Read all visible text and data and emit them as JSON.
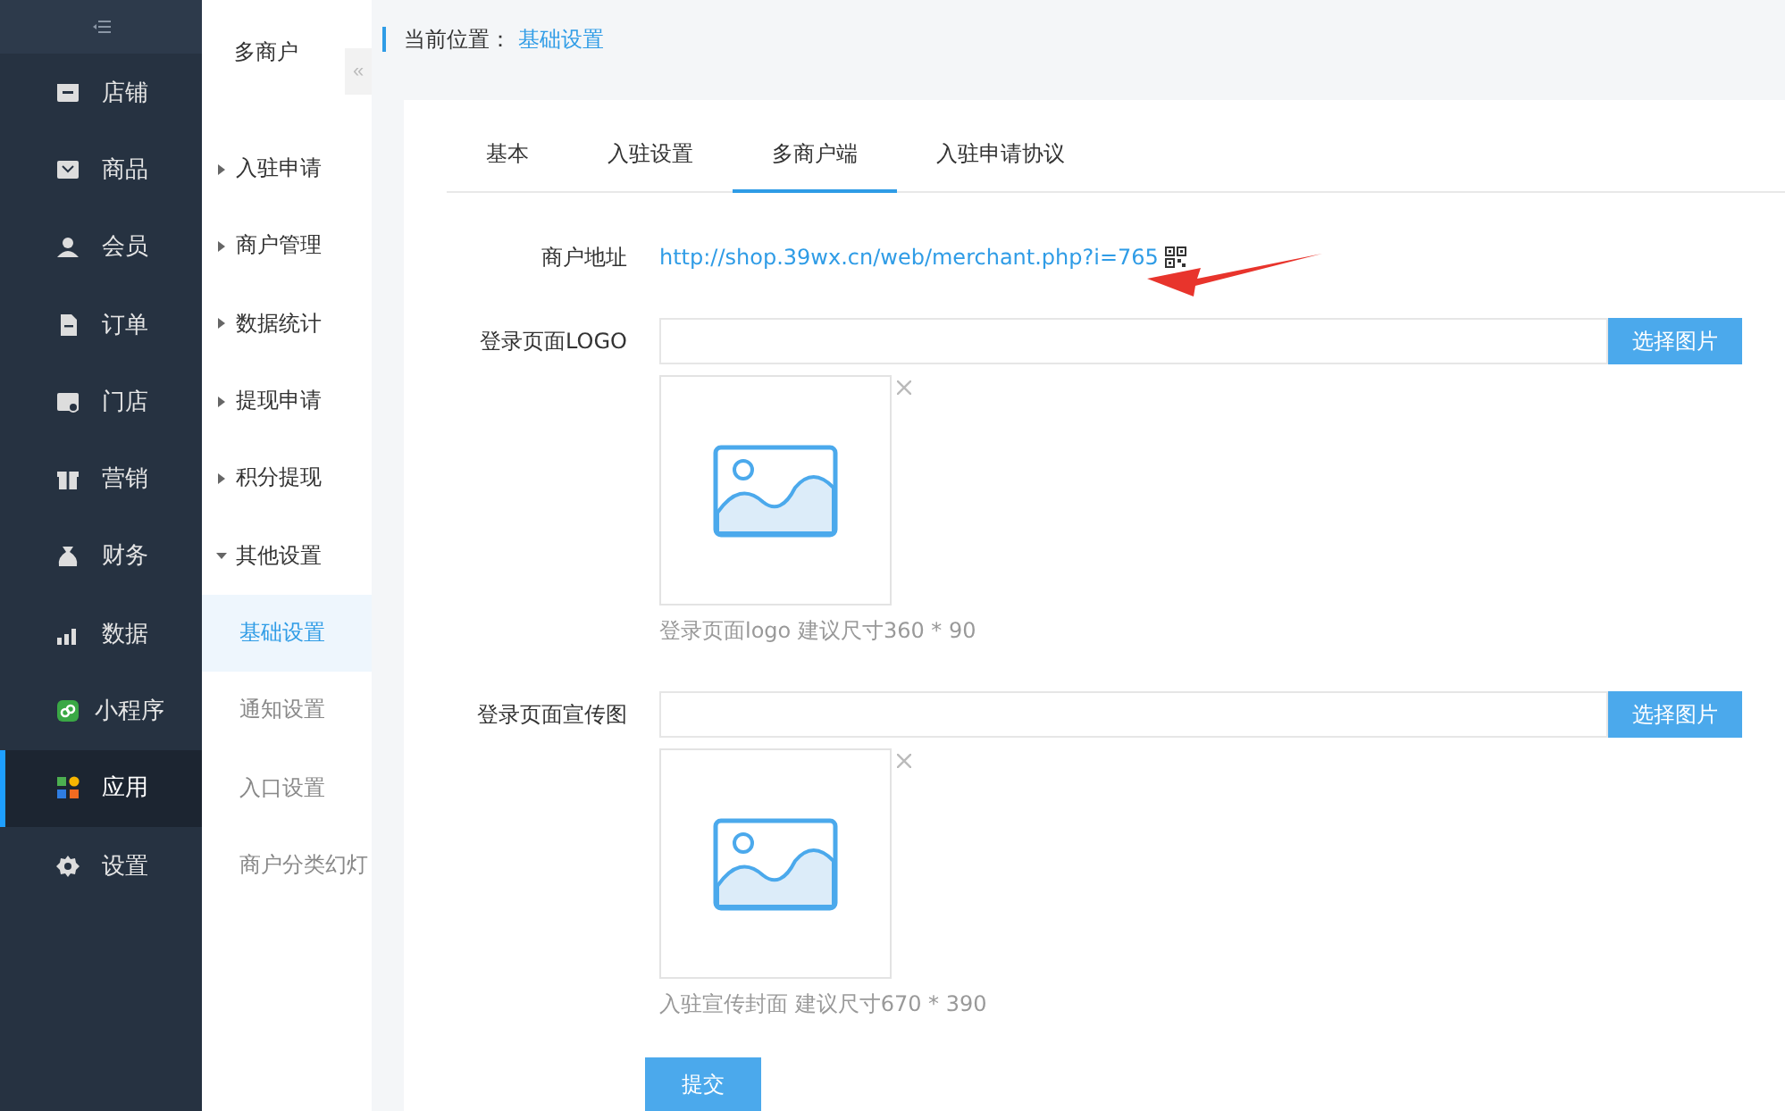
{
  "sidebar": {
    "items": [
      {
        "label": "店铺",
        "selected": false
      },
      {
        "label": "商品",
        "selected": false
      },
      {
        "label": "会员",
        "selected": false
      },
      {
        "label": "订单",
        "selected": false
      },
      {
        "label": "门店",
        "selected": false
      },
      {
        "label": "营销",
        "selected": false
      },
      {
        "label": "财务",
        "selected": false
      },
      {
        "label": "数据",
        "selected": false
      },
      {
        "label": "小程序",
        "selected": false
      },
      {
        "label": "应用",
        "selected": true
      },
      {
        "label": "设置",
        "selected": false
      }
    ]
  },
  "submenu": {
    "title": "多商户",
    "collapse_button": "«",
    "items": [
      {
        "label": "入驻申请",
        "expanded": false
      },
      {
        "label": "商户管理",
        "expanded": false
      },
      {
        "label": "数据统计",
        "expanded": false
      },
      {
        "label": "提现申请",
        "expanded": false
      },
      {
        "label": "积分提现",
        "expanded": false
      },
      {
        "label": "其他设置",
        "expanded": true,
        "children": [
          {
            "label": "基础设置",
            "selected": true
          },
          {
            "label": "通知设置",
            "selected": false
          },
          {
            "label": "入口设置",
            "selected": false
          },
          {
            "label": "商户分类幻灯",
            "selected": false
          }
        ]
      }
    ]
  },
  "breadcrumb": {
    "label": "当前位置：",
    "current": "基础设置"
  },
  "tabs": [
    {
      "label": "基本",
      "selected": false
    },
    {
      "label": "入驻设置",
      "selected": false
    },
    {
      "label": "多商户端",
      "selected": true
    },
    {
      "label": "入驻申请协议",
      "selected": false
    }
  ],
  "form": {
    "address_label": "商户地址",
    "address_link": "http://shop.39wx.cn/web/merchant.php?i=765",
    "uploads": [
      {
        "label": "登录页面LOGO",
        "button": "选择图片",
        "hint": "登录页面logo 建议尺寸360 * 90"
      },
      {
        "label": "登录页面宣传图",
        "button": "选择图片",
        "hint": "入驻宣传封面 建议尺寸670 * 390"
      }
    ],
    "submit": "提交"
  }
}
